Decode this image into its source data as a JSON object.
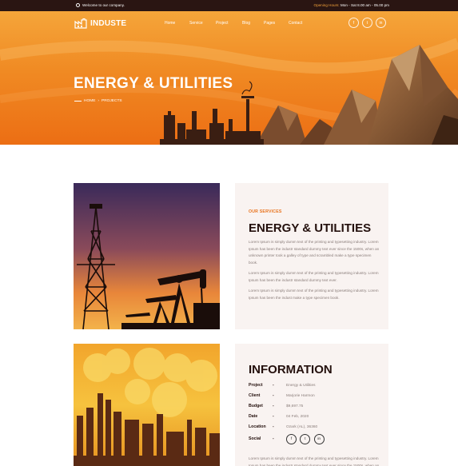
{
  "topbar": {
    "welcome": "Welcome to our company.",
    "hours_label": "Opening Hours:",
    "hours_value": "Mon - Sat 8.00 am - 05.00 pm"
  },
  "nav": {
    "logo": "INDUSTE",
    "menu": [
      "Home",
      "Service",
      "Project",
      "Blog",
      "Pages",
      "Contact"
    ],
    "social": [
      "f",
      "t",
      "in"
    ]
  },
  "hero": {
    "title": "ENERGY & UTILITIES",
    "breadcrumb_home": "HOME",
    "breadcrumb_sep": "›",
    "breadcrumb_current": "PROJECTS"
  },
  "service": {
    "eyebrow": "OUR SERVICES",
    "title": "ENERGY & UTILITIES",
    "para1": "Lorem Ipsum is simply dumm text of the printing and typesetting industry. Lorem Ipsum has been the industr standard dummy text ever since the 1500s, when an unknown printer took a galley of type and scrambled make a type specimen book.",
    "para2": "Lorem Ipsum is simply dumm text of the printing and typesetting industry. Lorem Ipsum has been the industr standard dummy text ever.",
    "para3": "Lorem Ipsum is simply dumm text of the printing and typesetting industry. Lorem Ipsum has been the indust make a type specimen book."
  },
  "information": {
    "title": "INFORMATION",
    "rows": [
      {
        "key": "Project",
        "sep": "-",
        "value": "Energy & Utilities"
      },
      {
        "key": "Client",
        "sep": "-",
        "value": "Marjorie Harmon"
      },
      {
        "key": "Budget",
        "sep": "-",
        "value": "$9,697.75"
      },
      {
        "key": "Date",
        "sep": "-",
        "value": "04 Feb, 2020"
      },
      {
        "key": "Location",
        "sep": "-",
        "value": "Ozark (AL), 36360"
      },
      {
        "key": "Social",
        "sep": "-",
        "value": ""
      }
    ],
    "social": [
      "f",
      "t",
      "in"
    ],
    "para": "Lorem Ipsum is simply dumm text of the printing and typesetting industry. Lorem Ipsum has been the industr standard dummy text ever since the 1500s, when an unknown printer took a galley of type."
  },
  "colors": {
    "accent": "#e8731e",
    "topbar": "#2a1512",
    "heading": "#24100d",
    "panel": "#f9f3f1"
  }
}
